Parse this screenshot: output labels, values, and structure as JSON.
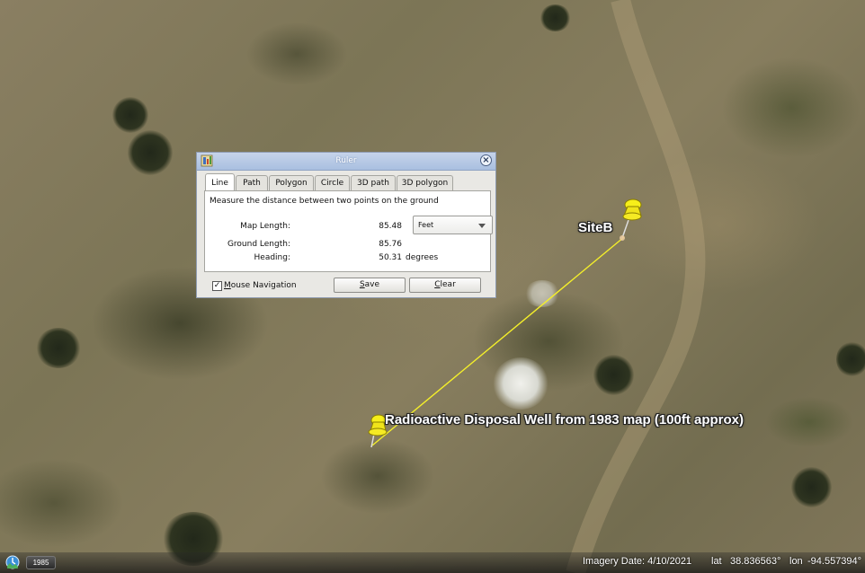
{
  "ruler": {
    "title": "Ruler",
    "tabs": [
      "Line",
      "Path",
      "Polygon",
      "Circle",
      "3D path",
      "3D polygon"
    ],
    "active_tab": "Line",
    "description": "Measure the distance between two points on the ground",
    "map_length_label": "Map Length:",
    "map_length_value": "85.48",
    "units": "Feet",
    "ground_length_label": "Ground Length:",
    "ground_length_value": "85.76",
    "heading_label": "Heading:",
    "heading_value": "50.31",
    "heading_unit": "degrees",
    "mouse_navigation_label": "Mouse Navigation",
    "mouse_navigation_checked": true,
    "save_label": "Save",
    "clear_label": "Clear"
  },
  "placemarks": {
    "site_b": "SiteB",
    "well": "Radioactive Disposal Well from 1983 map (100ft approx)"
  },
  "measure_line_color": "#f4ef2a",
  "status": {
    "year": "1985",
    "imagery_date": "Imagery Date: 4/10/2021",
    "lat_label": "lat",
    "lat_value": "38.836563°",
    "lon_label": "lon",
    "lon_value": "-94.557394°"
  },
  "icons": {
    "app": "ruler-app-icon",
    "close": "close-icon",
    "pushpin": "yellow-pushpin-icon",
    "history": "historical-imagery-clock-icon"
  }
}
